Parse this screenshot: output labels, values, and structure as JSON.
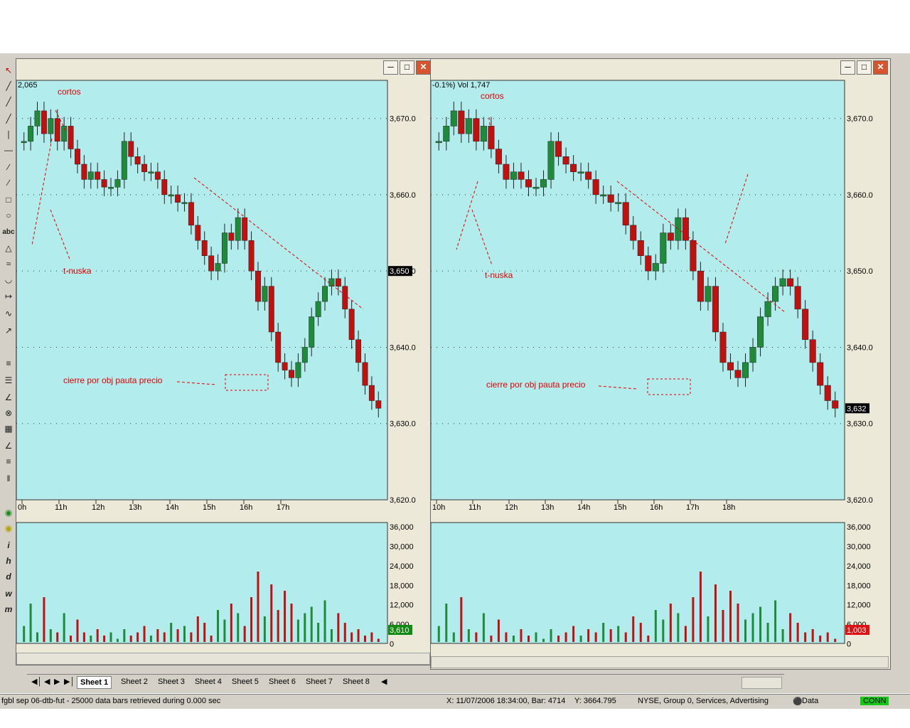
{
  "app": {
    "status_text": "fgbl sep 06-dtb-fut - 25000 data bars retrieved during 0.000 sec",
    "cursor_readout": "X: 11/07/2006 18:34:00, Bar: 4714",
    "y_readout": "Y: 3664.795",
    "exchange_info": "NYSE, Group 0, Services, Advertising",
    "data_label": "Data",
    "conn_label": "CONN"
  },
  "sheets": [
    "Sheet 1",
    "Sheet 2",
    "Sheet 3",
    "Sheet 4",
    "Sheet 5",
    "Sheet 6",
    "Sheet 7",
    "Sheet 8"
  ],
  "left_chart": {
    "header": "2,065",
    "last_price": "3,650",
    "volume_last": "3,610",
    "time_labels": [
      "0h",
      "11h",
      "12h",
      "13h",
      "14h",
      "15h",
      "16h",
      "17h"
    ],
    "annotations": {
      "cortos": "cortos",
      "t_nuska": "t-nuska",
      "cierre": "cierre  por obj pauta precio"
    }
  },
  "right_chart": {
    "header": "-0.1%) Vol 1,747",
    "last_price": "3,632",
    "volume_last": "1,003",
    "time_labels": [
      "10h",
      "11h",
      "12h",
      "13h",
      "14h",
      "15h",
      "16h",
      "17h",
      "18h"
    ],
    "annotations": {
      "cortos": "cortos",
      "t_nuska": "t-nuska",
      "cierre": "cierre  por obj pauta precio"
    }
  },
  "price_axis": [
    "3,670.0",
    "3,660.0",
    "3,650.0",
    "3,640.0",
    "3,630.0",
    "3,620.0"
  ],
  "volume_axis": [
    "36,000",
    "30,000",
    "24,000",
    "18,000",
    "12,000",
    "6,000",
    "0"
  ],
  "colors": {
    "bg": "#b3ecec",
    "up": "#1e8a3a",
    "down": "#c01010",
    "annotation": "#e00000"
  },
  "chart_data": {
    "type": "candlestick",
    "ylim": [
      3620,
      3675
    ],
    "volume_ylim": [
      0,
      36000
    ],
    "series": [
      {
        "name": "price",
        "close": [
          3667,
          3669,
          3671,
          3668,
          3670,
          3667,
          3669,
          3666,
          3664,
          3662,
          3663,
          3662,
          3661,
          3661,
          3662,
          3667,
          3665,
          3664,
          3663,
          3663,
          3662,
          3660,
          3660,
          3659,
          3659,
          3656,
          3654,
          3652,
          3650,
          3651,
          3655,
          3654,
          3657,
          3654,
          3650,
          3646,
          3648,
          3642,
          3638,
          3637,
          3636,
          3638,
          3640,
          3644,
          3646,
          3648,
          3649,
          3648,
          3645,
          3641,
          3638,
          3635,
          3633,
          3632
        ],
        "volume": [
          5000,
          12000,
          3000,
          14000,
          4000,
          3000,
          9000,
          2000,
          7000,
          3000,
          2000,
          4000,
          2000,
          3000,
          1000,
          4000,
          2000,
          3000,
          5000,
          2000,
          4000,
          3000,
          6000,
          4000,
          5000,
          3000,
          8000,
          6000,
          2000,
          10000,
          7000,
          12000,
          9000,
          5000,
          14000,
          22000,
          8000,
          18000,
          10000,
          16000,
          12000,
          7000,
          9000,
          11000,
          6000,
          13000,
          4000,
          9000,
          6000,
          3000,
          4000,
          2000,
          3000,
          1000
        ]
      }
    ]
  }
}
